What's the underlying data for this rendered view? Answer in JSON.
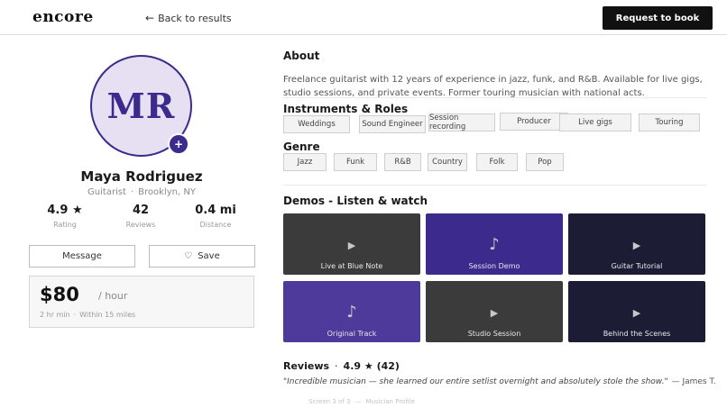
{
  "header": {
    "logo": "encore",
    "back_label": "Back to results",
    "cta_label": "Request to book"
  },
  "profile": {
    "initials": "MR",
    "add_label": "+",
    "name": "Maya Rodriguez",
    "role": "Guitarist",
    "sep": "·",
    "location": "Brooklyn, NY",
    "stats": [
      {
        "value": "4.9 ★",
        "label": "Rating"
      },
      {
        "value": "42",
        "label": "Reviews"
      },
      {
        "value": "0.4 mi",
        "label": "Distance"
      }
    ],
    "message_label": "Message",
    "save_label": "Save",
    "price": "$80",
    "per": "/ hour",
    "min_booking": "2 hr min",
    "radius": "Within 15 miles"
  },
  "about": {
    "title": "About",
    "text": "Freelance guitarist with 12 years of experience in jazz, funk, and R&B. Available for live gigs, studio sessions, and private events. Former touring musician with national acts."
  },
  "instruments": {
    "title": "Instruments & Roles",
    "chips": [
      "Weddings",
      "Sound Engineer",
      "Session recording",
      "Producer",
      "Live gigs",
      "Touring"
    ]
  },
  "genre": {
    "title": "Genre",
    "chips": [
      "Jazz",
      "Funk",
      "R&B",
      "Country",
      "Folk",
      "Pop"
    ]
  },
  "demos": {
    "title": "Demos - Listen & watch",
    "items": [
      {
        "caption": "Live at Blue Note",
        "glyph": "▶",
        "color": "#3b3b3b"
      },
      {
        "caption": "Session Demo",
        "glyph": "♪",
        "color": "#3c2a8c"
      },
      {
        "caption": "Guitar Tutorial",
        "glyph": "▶",
        "color": "#1c1c34"
      },
      {
        "caption": "Original Track",
        "glyph": "♪",
        "color": "#4d3a9a"
      },
      {
        "caption": "Studio Session",
        "glyph": "▶",
        "color": "#3b3b3b"
      },
      {
        "caption": "Behind the Scenes",
        "glyph": "▶",
        "color": "#1c1c34"
      }
    ]
  },
  "reviews": {
    "title": "Reviews",
    "sep": "·",
    "rating": "4.9 ★",
    "count": "(42)",
    "quote": "\"Incredible musician — she learned our entire setlist overnight and absolutely stole the show.\"",
    "author": "— James T."
  },
  "footer": {
    "screen": "Screen 3 of 3",
    "sep": "—",
    "name": "Musician Profile"
  },
  "colors": {
    "accent": "#3c2a8c",
    "avatar_bg": "#e7e0f2",
    "cta_bg": "#111111"
  }
}
